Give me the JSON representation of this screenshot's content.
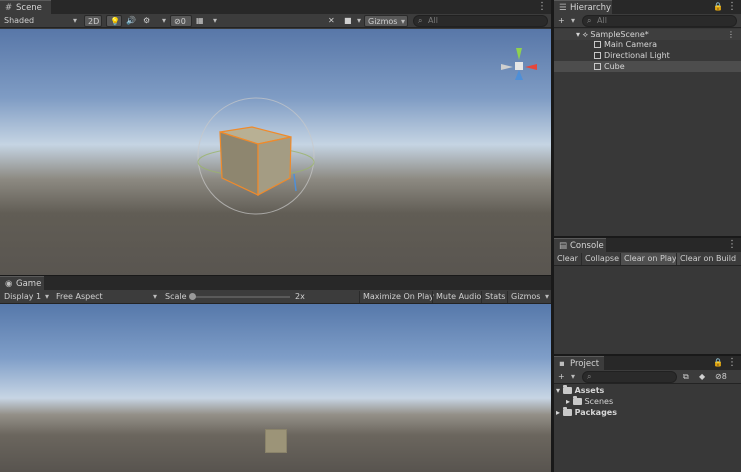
{
  "scene_tab": {
    "label": "Scene"
  },
  "scene_toolbar": {
    "shading_mode": "Shaded",
    "mode_2d": "2D",
    "fx_count": "0",
    "gizmos": "Gizmos",
    "search_placeholder": "All"
  },
  "game_tab": {
    "label": "Game"
  },
  "game_toolbar": {
    "display": "Display 1",
    "aspect": "Free Aspect",
    "scale_label": "Scale",
    "scale_value": "2x",
    "maximize": "Maximize On Play",
    "mute": "Mute Audio",
    "stats": "Stats",
    "gizmos": "Gizmos"
  },
  "hierarchy": {
    "title": "Hierarchy",
    "search_placeholder": "All",
    "scene": "SampleScene*",
    "items": [
      "Main Camera",
      "Directional Light",
      "Cube"
    ],
    "selected": "Cube"
  },
  "console": {
    "title": "Console",
    "buttons": [
      "Clear",
      "Collapse",
      "Clear on Play",
      "Clear on Build"
    ]
  },
  "project": {
    "title": "Project",
    "hidden_count": "8",
    "tree": {
      "assets": "Assets",
      "scenes": "Scenes",
      "packages": "Packages"
    }
  },
  "colors": {
    "selection": "#4d4d4d",
    "cube_outline": "#f08a2a",
    "gizmo_y": "#8fd14f",
    "gizmo_x": "#e4473c",
    "gizmo_z": "#4e8fd8"
  }
}
